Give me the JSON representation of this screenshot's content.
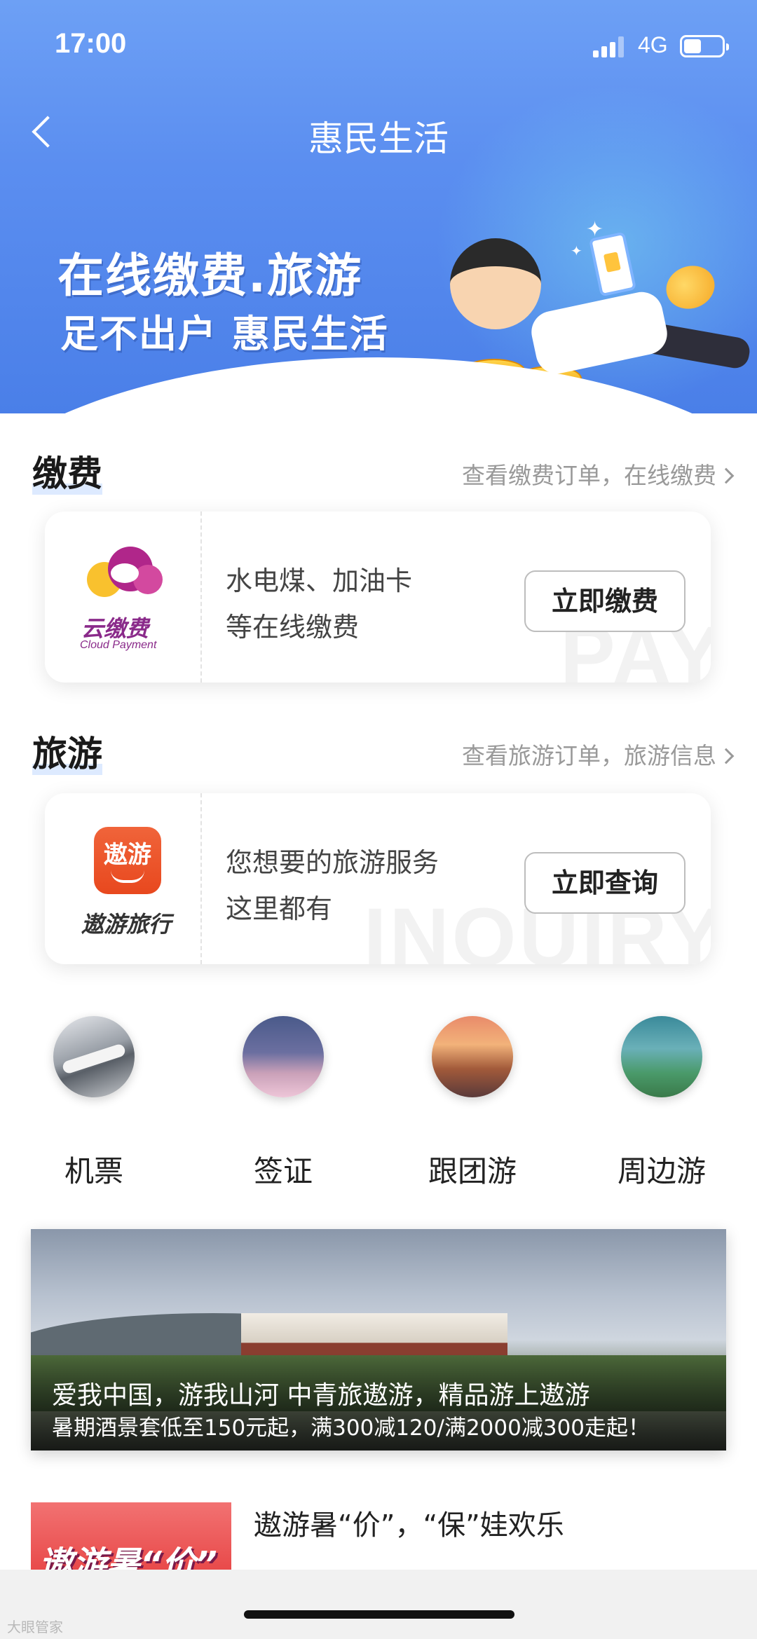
{
  "status_bar": {
    "time": "17:00",
    "network": "4G"
  },
  "nav": {
    "title": "惠民生活"
  },
  "hero": {
    "line1": "在线缴费.旅游",
    "line2": "足不出户 惠民生活"
  },
  "payment": {
    "section_title": "缴费",
    "link_text": "查看缴费订单，在线缴费",
    "logo_cn": "云缴费",
    "logo_en": "Cloud Payment",
    "desc_line1": "水电煤、加油卡",
    "desc_line2": "等在线缴费",
    "button_label": "立即缴费",
    "watermark": "PAY"
  },
  "travel": {
    "section_title": "旅游",
    "link_text": "查看旅游订单，旅游信息",
    "logo_icon_text": "遨游",
    "logo_name": "遨游旅行",
    "desc_line1": "您想要的旅游服务",
    "desc_line2": "这里都有",
    "button_label": "立即查询",
    "watermark": "INQUIRY"
  },
  "travel_categories": [
    {
      "label": "机票"
    },
    {
      "label": "签证"
    },
    {
      "label": "跟团游"
    },
    {
      "label": "周边游"
    }
  ],
  "banner": {
    "title": "爱我中国，游我山河 中青旅遨游，精品游上遨游",
    "subtitle": "暑期酒景套低至150元起，满300减120/满2000减300走起！"
  },
  "article": {
    "thumb_text": "遨游暑“价”",
    "title": "遨游暑“价”，“保”娃欢乐"
  },
  "watermark_brand": "大眼管家"
}
